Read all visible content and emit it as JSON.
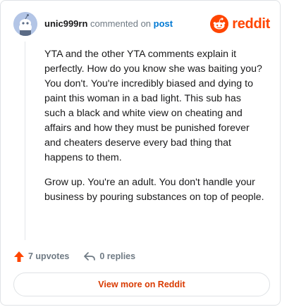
{
  "header": {
    "username": "unic999rn",
    "action_text": "commented on",
    "link_text": "post",
    "brand": "reddit"
  },
  "comment": {
    "paragraphs": [
      "YTA and the other YTA comments explain it perfectly. How do you know she was baiting you? You don't. You're incredibly biased and dying to paint this woman in a bad light. This sub has such a black and white view on cheating and affairs and how they must be punished forever and cheaters deserve every bad thing that happens to them.",
      "Grow up. You're an adult. You don't handle your business by pouring substances on top of people."
    ]
  },
  "actions": {
    "upvotes": "7 upvotes",
    "replies": "0 replies"
  },
  "footer": {
    "view_more": "View more on Reddit"
  },
  "colors": {
    "brand": "#ff4500",
    "link": "#0079d3",
    "view_more": "#d93a00",
    "avatar_bg": "#b3c5e6"
  }
}
